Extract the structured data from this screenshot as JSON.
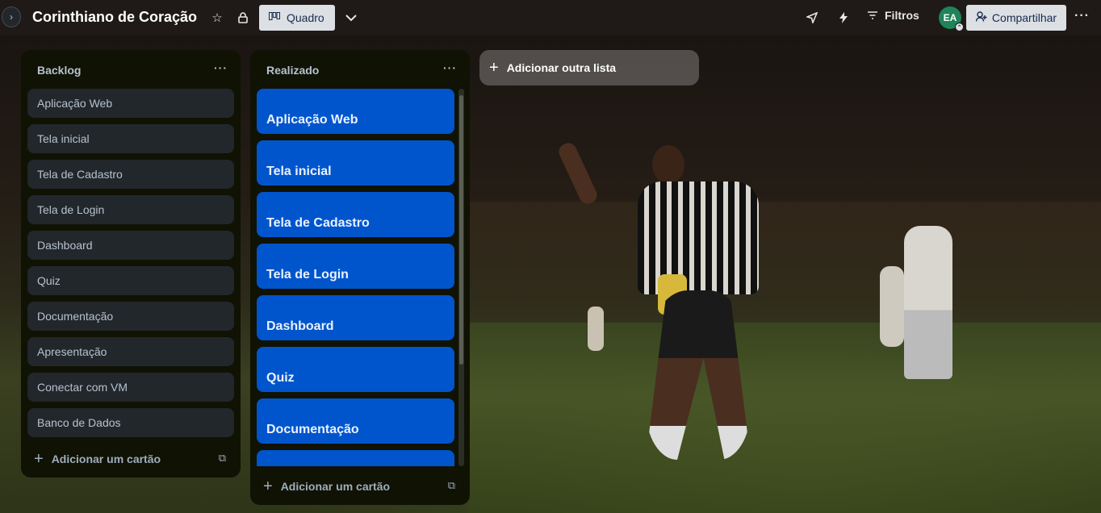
{
  "header": {
    "board_title": "Corinthiano de Coração",
    "view_label": "Quadro",
    "filters_label": "Filtros",
    "avatar_initials": "EA",
    "share_label": "Compartilhar"
  },
  "lists": [
    {
      "title": "Backlog",
      "cards": [
        "Aplicação Web",
        "Tela inicial",
        "Tela de Cadastro",
        "Tela de Login",
        "Dashboard",
        "Quiz",
        "Documentação",
        "Apresentação",
        "Conectar com VM",
        "Banco de Dados"
      ],
      "add_card_label": "Adicionar um cartão"
    },
    {
      "title": "Realizado",
      "cards": [
        "Aplicação Web",
        "Tela inicial",
        "Tela de Cadastro",
        "Tela de Login",
        "Dashboard",
        "Quiz",
        "Documentação",
        ""
      ],
      "add_card_label": "Adicionar um cartão"
    }
  ],
  "add_list_label": "Adicionar outra lista",
  "colors": {
    "header_bg": "#1f1a17",
    "list_bg": "#101204",
    "card_bg": "#22272b",
    "card_done_bg": "#0055cc",
    "avatar_bg": "#1f845a"
  }
}
